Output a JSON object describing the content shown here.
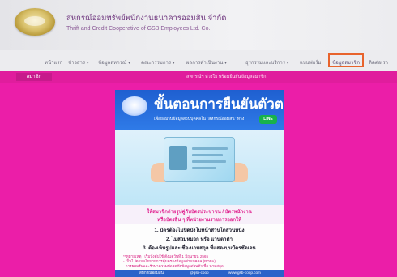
{
  "header": {
    "title_th": "สหกรณ์ออมทรัพย์พนักงานธนาคารออมสิน จำกัด",
    "title_en": "Thrift and Credit Cooperative of GSB Employees Ltd. Co."
  },
  "nav": {
    "items": [
      {
        "label": "หน้าแรก"
      },
      {
        "label": "ข่าวสาร ▾"
      },
      {
        "label": "ข้อมูลสหกรณ์ ▾"
      },
      {
        "label": "คณะกรรมการ ▾"
      },
      {
        "label": "ผลการดำเนินงาน ▾"
      },
      {
        "label": "ธุรกรรมและบริการ ▾"
      },
      {
        "label": "แบบฟอร์ม"
      },
      {
        "label": "ข้อมูลสมาชิก"
      },
      {
        "label": "ติดต่อเรา"
      }
    ],
    "active_label": "ข้อมูลสมาชิก"
  },
  "content": {
    "home_tab": "สมาชิก",
    "breadcrumb": "สหกรณ์ฯ ห่วงใย พร้อมยืนยันข้อมูลสมาชิก"
  },
  "poster": {
    "title": "ขั้นตอนการยืนยันตัวตน",
    "subtitle": "เพื่อยอมรับข้อมูลส่วนบุคคลใน \"สหกรณ์ออมสิน\" ทาง",
    "badge": "LINE",
    "highlight_1": "ให้สมาชิกถ่ายรูปคู่กับบัตรประชาชน / บัตรพนักงาน",
    "highlight_2": "หรือบัตรอื่น ๆ ที่หน่วยงานราชการออกให้",
    "steps": [
      "1. บัตรต้องไม่ปิดบังใบหน้าส่วนใดส่วนหนึ่ง",
      "2. ไม่สวมหมวก หรือ แว่นตาดำ",
      "3. ต้องเห็นรูปและ ชื่อ-นามสกุล ที่แสดงบนบัตรชัดเจน"
    ],
    "notes": [
      "**หมายเหตุ : เริ่มบังคับใช้ ตั้งแต่วันที่ 1 มิถุนายน 2565",
      "- เป็นไปตามนโยบายการคุ้มครองข้อมูลส่วนบุคคล (PDPA)",
      "- การยอมรับและรักษาความปลอดภัยข้อมูลส่วนตัว ชื่อ-นามสกุล"
    ],
    "footer": [
      "สหกรณ์ออมสิน",
      "@gsb-coop",
      "www.gsb-coop.com"
    ]
  }
}
